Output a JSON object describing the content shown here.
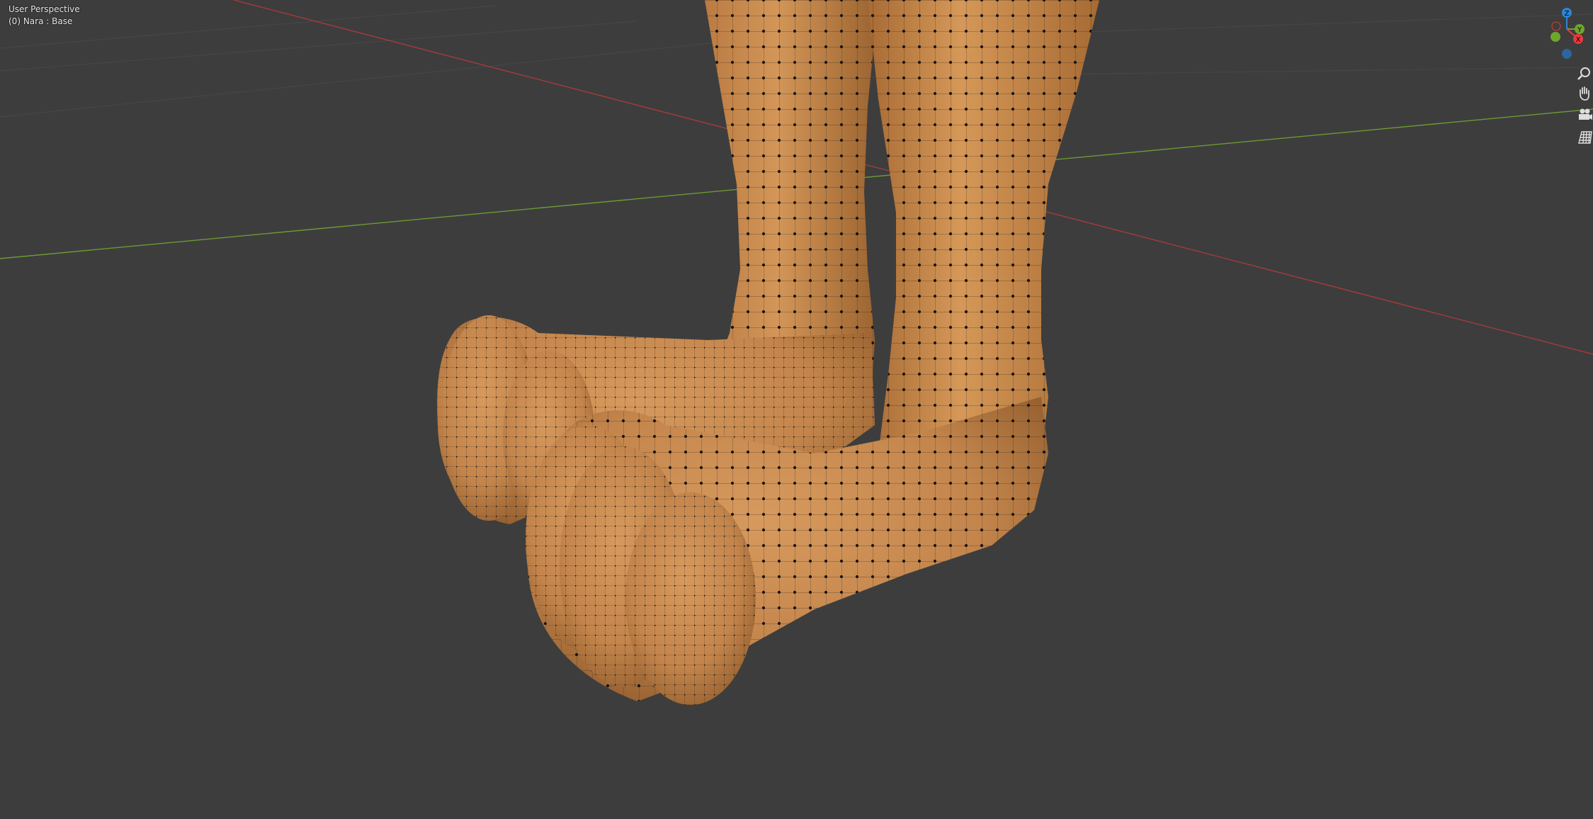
{
  "viewport": {
    "view_name": "User Perspective",
    "object_info": "(0) Nara : Base",
    "background_color": "#3d3d3d",
    "grid_line_color": "#484848",
    "x_axis_color": "#a63b3b",
    "y_axis_color": "#6b9a33",
    "mesh_color": "#c8874d",
    "vertex_color": "#1a1a1a"
  },
  "gizmo": {
    "z_label": "Z",
    "y_label": "Y",
    "x_label": "X",
    "x_color": "#e8393d",
    "y_color": "#6ea62b",
    "z_color": "#2e84d6"
  },
  "nav_tools": [
    {
      "name": "zoom-icon"
    },
    {
      "name": "hand-pan-icon"
    },
    {
      "name": "camera-icon"
    },
    {
      "name": "grid-ortho-icon"
    }
  ]
}
